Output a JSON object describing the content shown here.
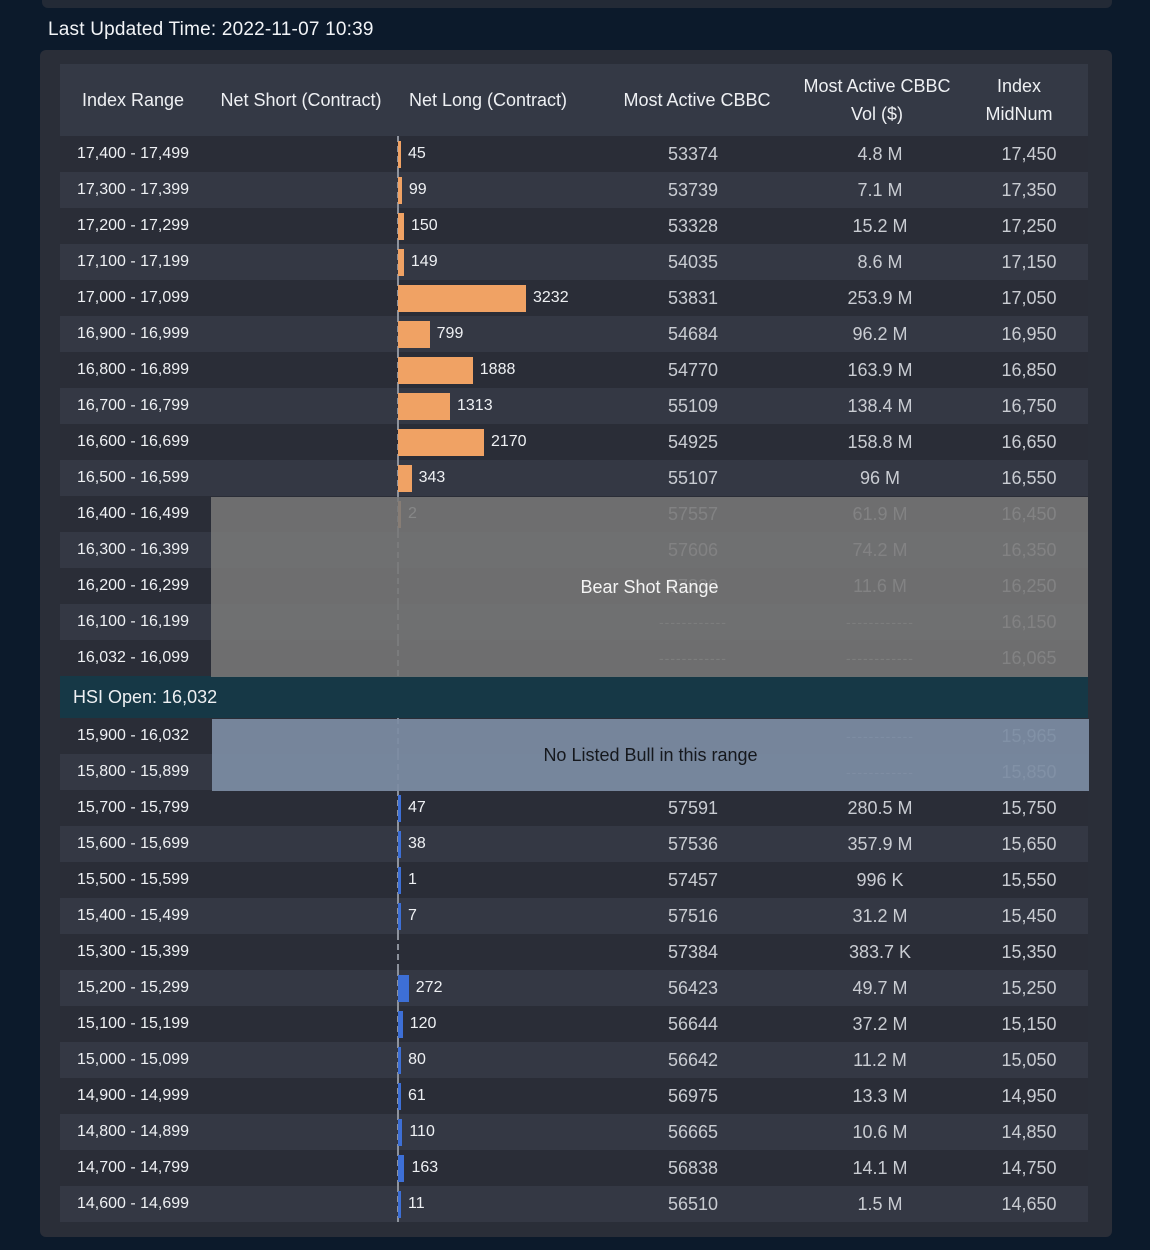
{
  "last_updated": "Last Updated Time: 2022-11-07 10:39",
  "headers": {
    "index_range": "Index Range",
    "net_short": "Net Short (Contract)",
    "net_long": "Net Long (Contract)",
    "most_active": "Most Active CBBC",
    "active_vol_line1": "Most Active CBBC",
    "active_vol_line2": "Vol ($)",
    "midnum_line1": "Index",
    "midnum_line2": "MidNum"
  },
  "colors": {
    "bear_bar": "#f0a264",
    "bull_bar": "#3d6fd6",
    "hsi_band": "#163846"
  },
  "bear_rows": [
    {
      "range": "17,400 - 17,499",
      "long": "45",
      "code": "53374",
      "vol": "4.8 M",
      "mid": "17,450"
    },
    {
      "range": "17,300 - 17,399",
      "long": "99",
      "code": "53739",
      "vol": "7.1 M",
      "mid": "17,350"
    },
    {
      "range": "17,200 - 17,299",
      "long": "150",
      "code": "53328",
      "vol": "15.2 M",
      "mid": "17,250"
    },
    {
      "range": "17,100 - 17,199",
      "long": "149",
      "code": "54035",
      "vol": "8.6 M",
      "mid": "17,150"
    },
    {
      "range": "17,000 - 17,099",
      "long": "3232",
      "code": "53831",
      "vol": "253.9 M",
      "mid": "17,050"
    },
    {
      "range": "16,900 - 16,999",
      "long": "799",
      "code": "54684",
      "vol": "96.2 M",
      "mid": "16,950"
    },
    {
      "range": "16,800 - 16,899",
      "long": "1888",
      "code": "54770",
      "vol": "163.9 M",
      "mid": "16,850"
    },
    {
      "range": "16,700 - 16,799",
      "long": "1313",
      "code": "55109",
      "vol": "138.4 M",
      "mid": "16,750"
    },
    {
      "range": "16,600 - 16,699",
      "long": "2170",
      "code": "54925",
      "vol": "158.8 M",
      "mid": "16,650"
    },
    {
      "range": "16,500 - 16,599",
      "long": "343",
      "code": "55107",
      "vol": "96 M",
      "mid": "16,550"
    },
    {
      "range": "16,400 - 16,499",
      "long": "2",
      "code": "57557",
      "vol": "61.9 M",
      "mid": "16,450"
    },
    {
      "range": "16,300 - 16,399",
      "long": "",
      "code": "57606",
      "vol": "74.2 M",
      "mid": "16,350"
    },
    {
      "range": "16,200 - 16,299",
      "long": "",
      "code": "57839",
      "vol": "11.6 M",
      "mid": "16,250"
    },
    {
      "range": "16,100 - 16,199",
      "long": "",
      "code": "------------",
      "vol": "------------",
      "mid": "16,150"
    },
    {
      "range": "16,032 - 16,099",
      "long": "",
      "code": "------------",
      "vol": "------------",
      "mid": "16,065"
    }
  ],
  "bear_overlay": "Bear Shot Range",
  "hsi_open": "HSI Open: 16,032",
  "bull_overlay": "No Listed Bull in this range",
  "bull_rows": [
    {
      "range": "15,900 - 16,032",
      "long": "",
      "code": "",
      "vol": "------------",
      "mid": "15,965"
    },
    {
      "range": "15,800 - 15,899",
      "long": "",
      "code": "",
      "vol": "------------",
      "mid": "15,850"
    },
    {
      "range": "15,700 - 15,799",
      "long": "47",
      "code": "57591",
      "vol": "280.5 M",
      "mid": "15,750"
    },
    {
      "range": "15,600 - 15,699",
      "long": "38",
      "code": "57536",
      "vol": "357.9 M",
      "mid": "15,650"
    },
    {
      "range": "15,500 - 15,599",
      "long": "1",
      "code": "57457",
      "vol": "996 K",
      "mid": "15,550"
    },
    {
      "range": "15,400 - 15,499",
      "long": "7",
      "code": "57516",
      "vol": "31.2 M",
      "mid": "15,450"
    },
    {
      "range": "15,300 - 15,399",
      "long": "",
      "code": "57384",
      "vol": "383.7 K",
      "mid": "15,350"
    },
    {
      "range": "15,200 - 15,299",
      "long": "272",
      "code": "56423",
      "vol": "49.7 M",
      "mid": "15,250"
    },
    {
      "range": "15,100 - 15,199",
      "long": "120",
      "code": "56644",
      "vol": "37.2 M",
      "mid": "15,150"
    },
    {
      "range": "15,000 - 15,099",
      "long": "80",
      "code": "56642",
      "vol": "11.2 M",
      "mid": "15,050"
    },
    {
      "range": "14,900 - 14,999",
      "long": "61",
      "code": "56975",
      "vol": "13.3 M",
      "mid": "14,950"
    },
    {
      "range": "14,800 - 14,899",
      "long": "110",
      "code": "56665",
      "vol": "10.6 M",
      "mid": "14,850"
    },
    {
      "range": "14,700 - 14,799",
      "long": "163",
      "code": "56838",
      "vol": "14.1 M",
      "mid": "14,750"
    },
    {
      "range": "14,600 - 14,699",
      "long": "11",
      "code": "56510",
      "vol": "1.5 M",
      "mid": "14,650"
    }
  ]
}
